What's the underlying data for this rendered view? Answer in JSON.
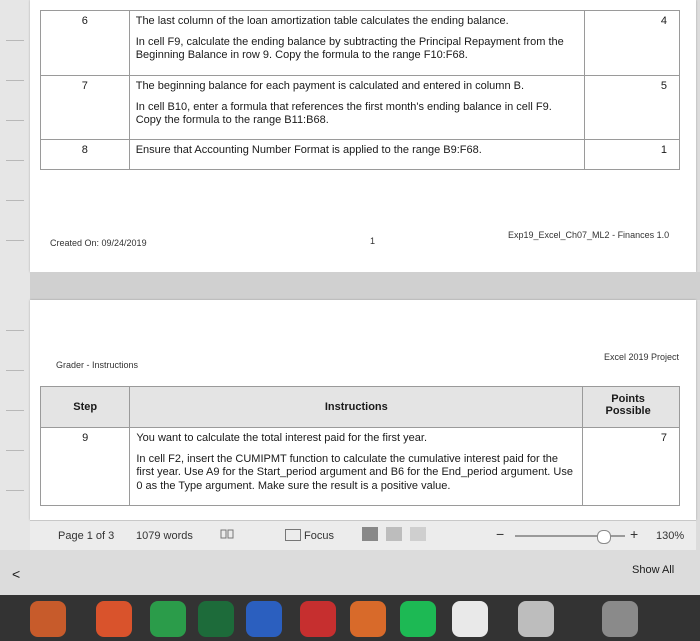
{
  "page1": {
    "rows": [
      {
        "step": "6",
        "points": "4",
        "paras": [
          "The last column of the loan amortization table calculates the ending balance.",
          "In cell F9, calculate the ending balance by subtracting the Principal Repayment from the Beginning Balance in row 9. Copy the formula to the range F10:F68."
        ]
      },
      {
        "step": "7",
        "points": "5",
        "paras": [
          "The beginning balance for each payment is calculated and entered in column B.",
          "In cell B10, enter a formula that references the first month's ending balance in cell F9. Copy the formula to the range B11:B68."
        ]
      },
      {
        "step": "8",
        "points": "1",
        "paras": [
          "Ensure that Accounting Number Format is applied to the range B9:F68."
        ]
      }
    ],
    "created_on": "Created On: 09/24/2019",
    "page_number": "1",
    "footer_file": "Exp19_Excel_Ch07_ML2 - Finances 1.0"
  },
  "page2": {
    "header_left": "Grader - Instructions",
    "header_right": "Excel 2019 Project",
    "columns": {
      "step": "Step",
      "instructions": "Instructions",
      "points": "Points Possible"
    },
    "row": {
      "step": "9",
      "points": "7",
      "paras": [
        "You want to calculate the total interest paid for the first year.",
        "In cell F2, insert the CUMIPMT function to calculate the cumulative interest paid for the first year. Use A9 for the Start_period argument and B6 for the End_period argument. Use 0 as the Type argument. Make sure the result is a positive value."
      ]
    }
  },
  "status": {
    "page": "Page 1 of 3",
    "words": "1079 words",
    "focus": "Focus",
    "zoom": "130%",
    "zoom_fraction": 0.8
  },
  "bottom": {
    "show_all": "Show All",
    "back_arrow": "<"
  },
  "icons": [
    "chevron-left-icon",
    "book-icon",
    "focus-icon",
    "read-mode-icon",
    "print-layout-icon",
    "web-layout-icon",
    "zoom-in-icon"
  ],
  "colors": {
    "accent": "#1f6fd1",
    "chrome": "#dcdcdc",
    "page": "#ffffff",
    "header_fill": "#e4e4e4"
  }
}
